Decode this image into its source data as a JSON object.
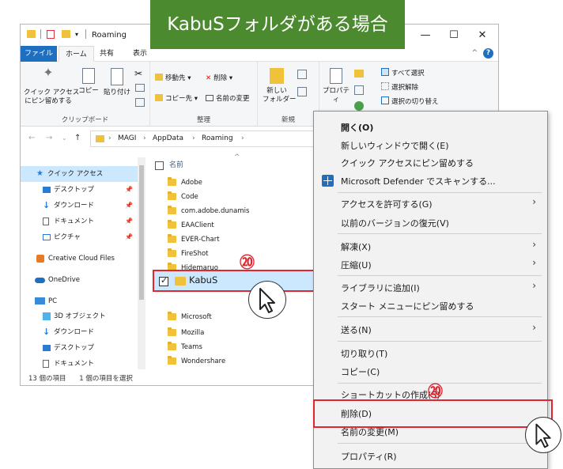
{
  "banner": {
    "text": "KabuSフォルダがある場合"
  },
  "window": {
    "title": "Roaming",
    "minimize": "—",
    "maximize": "☐",
    "close": "✕"
  },
  "tabs": [
    {
      "label": "ファイル"
    },
    {
      "label": "ホーム"
    },
    {
      "label": "共有"
    },
    {
      "label": "表示"
    }
  ],
  "ribbon": {
    "clipboard": {
      "group_label": "クリップボード",
      "pin_quick": "クイック アクセス\nにピン留めする",
      "copy": "コピー",
      "paste": "貼り付け"
    },
    "organize": {
      "group_label": "整理",
      "move_to": "移動先 ▾",
      "copy_to": "コピー先 ▾",
      "delete": "削除 ▾",
      "rename": "名前の変更"
    },
    "new": {
      "group_label": "新規",
      "new_folder": "新しい\nフォルダー"
    },
    "open": {
      "properties": "プロパティ"
    },
    "select": {
      "select_all": "すべて選択",
      "select_none": "選択解除",
      "invert": "選択の切り替え"
    }
  },
  "address": {
    "crumbs": [
      "MAGI",
      "AppData",
      "Roaming"
    ]
  },
  "navpane": {
    "items": [
      {
        "label": "クイック アクセス",
        "icon": "star-icon",
        "pinned": false,
        "selected": true
      },
      {
        "label": "デスクトップ",
        "icon": "desktop-icon",
        "pinned": true
      },
      {
        "label": "ダウンロード",
        "icon": "download-icon",
        "pinned": true
      },
      {
        "label": "ドキュメント",
        "icon": "document-icon",
        "pinned": true
      },
      {
        "label": "ピクチャ",
        "icon": "picture-icon",
        "pinned": true
      },
      {
        "label": "Creative Cloud Files",
        "icon": "creative-cloud-icon"
      },
      {
        "label": "OneDrive",
        "icon": "cloud-icon"
      },
      {
        "label": "PC",
        "icon": "pc-icon"
      },
      {
        "label": "3D オブジェクト",
        "icon": "cube-icon"
      },
      {
        "label": "ダウンロード",
        "icon": "download-icon"
      },
      {
        "label": "デスクトップ",
        "icon": "desktop-icon"
      },
      {
        "label": "ドキュメント",
        "icon": "document-icon"
      }
    ]
  },
  "filelist": {
    "column_name": "名前",
    "files": [
      "Adobe",
      "Code",
      "com.adobe.dunamis",
      "EAAClient",
      "EVER-Chart",
      "FireShot",
      "Hidemaruo",
      "KabuS",
      "Microsoft",
      "Mozilla",
      "Teams",
      "Wondershare"
    ],
    "selected": "KabuS"
  },
  "statusbar": {
    "count": "13 個の項目",
    "selection": "1 個の項目を選択"
  },
  "context_menu": {
    "items": [
      {
        "label": "開く(O)",
        "bold": true
      },
      {
        "label": "新しいウィンドウで開く(E)"
      },
      {
        "label": "クイック アクセスにピン留めする"
      },
      {
        "label": "Microsoft Defender でスキャンする..."
      },
      {
        "label": "アクセスを許可する(G)",
        "submenu": true
      },
      {
        "label": "以前のバージョンの復元(V)"
      },
      {
        "label": "解凍(X)",
        "submenu": true
      },
      {
        "label": "圧縮(U)",
        "submenu": true
      },
      {
        "label": "ライブラリに追加(I)",
        "submenu": true
      },
      {
        "label": "スタート メニューにピン留めする"
      },
      {
        "label": "送る(N)",
        "submenu": true
      },
      {
        "label": "切り取り(T)"
      },
      {
        "label": "コピー(C)"
      },
      {
        "label": "ショートカットの作成(S)"
      },
      {
        "label": "削除(D)",
        "highlighted": true
      },
      {
        "label": "名前の変更(M)"
      },
      {
        "label": "プロパティ(R)"
      }
    ]
  },
  "annotations": {
    "step_marker": "⑳"
  },
  "colors": {
    "accent": "#1f6fc0",
    "highlight": "#e0262f",
    "banner": "#4c8a2f",
    "selection": "#cce8ff"
  }
}
